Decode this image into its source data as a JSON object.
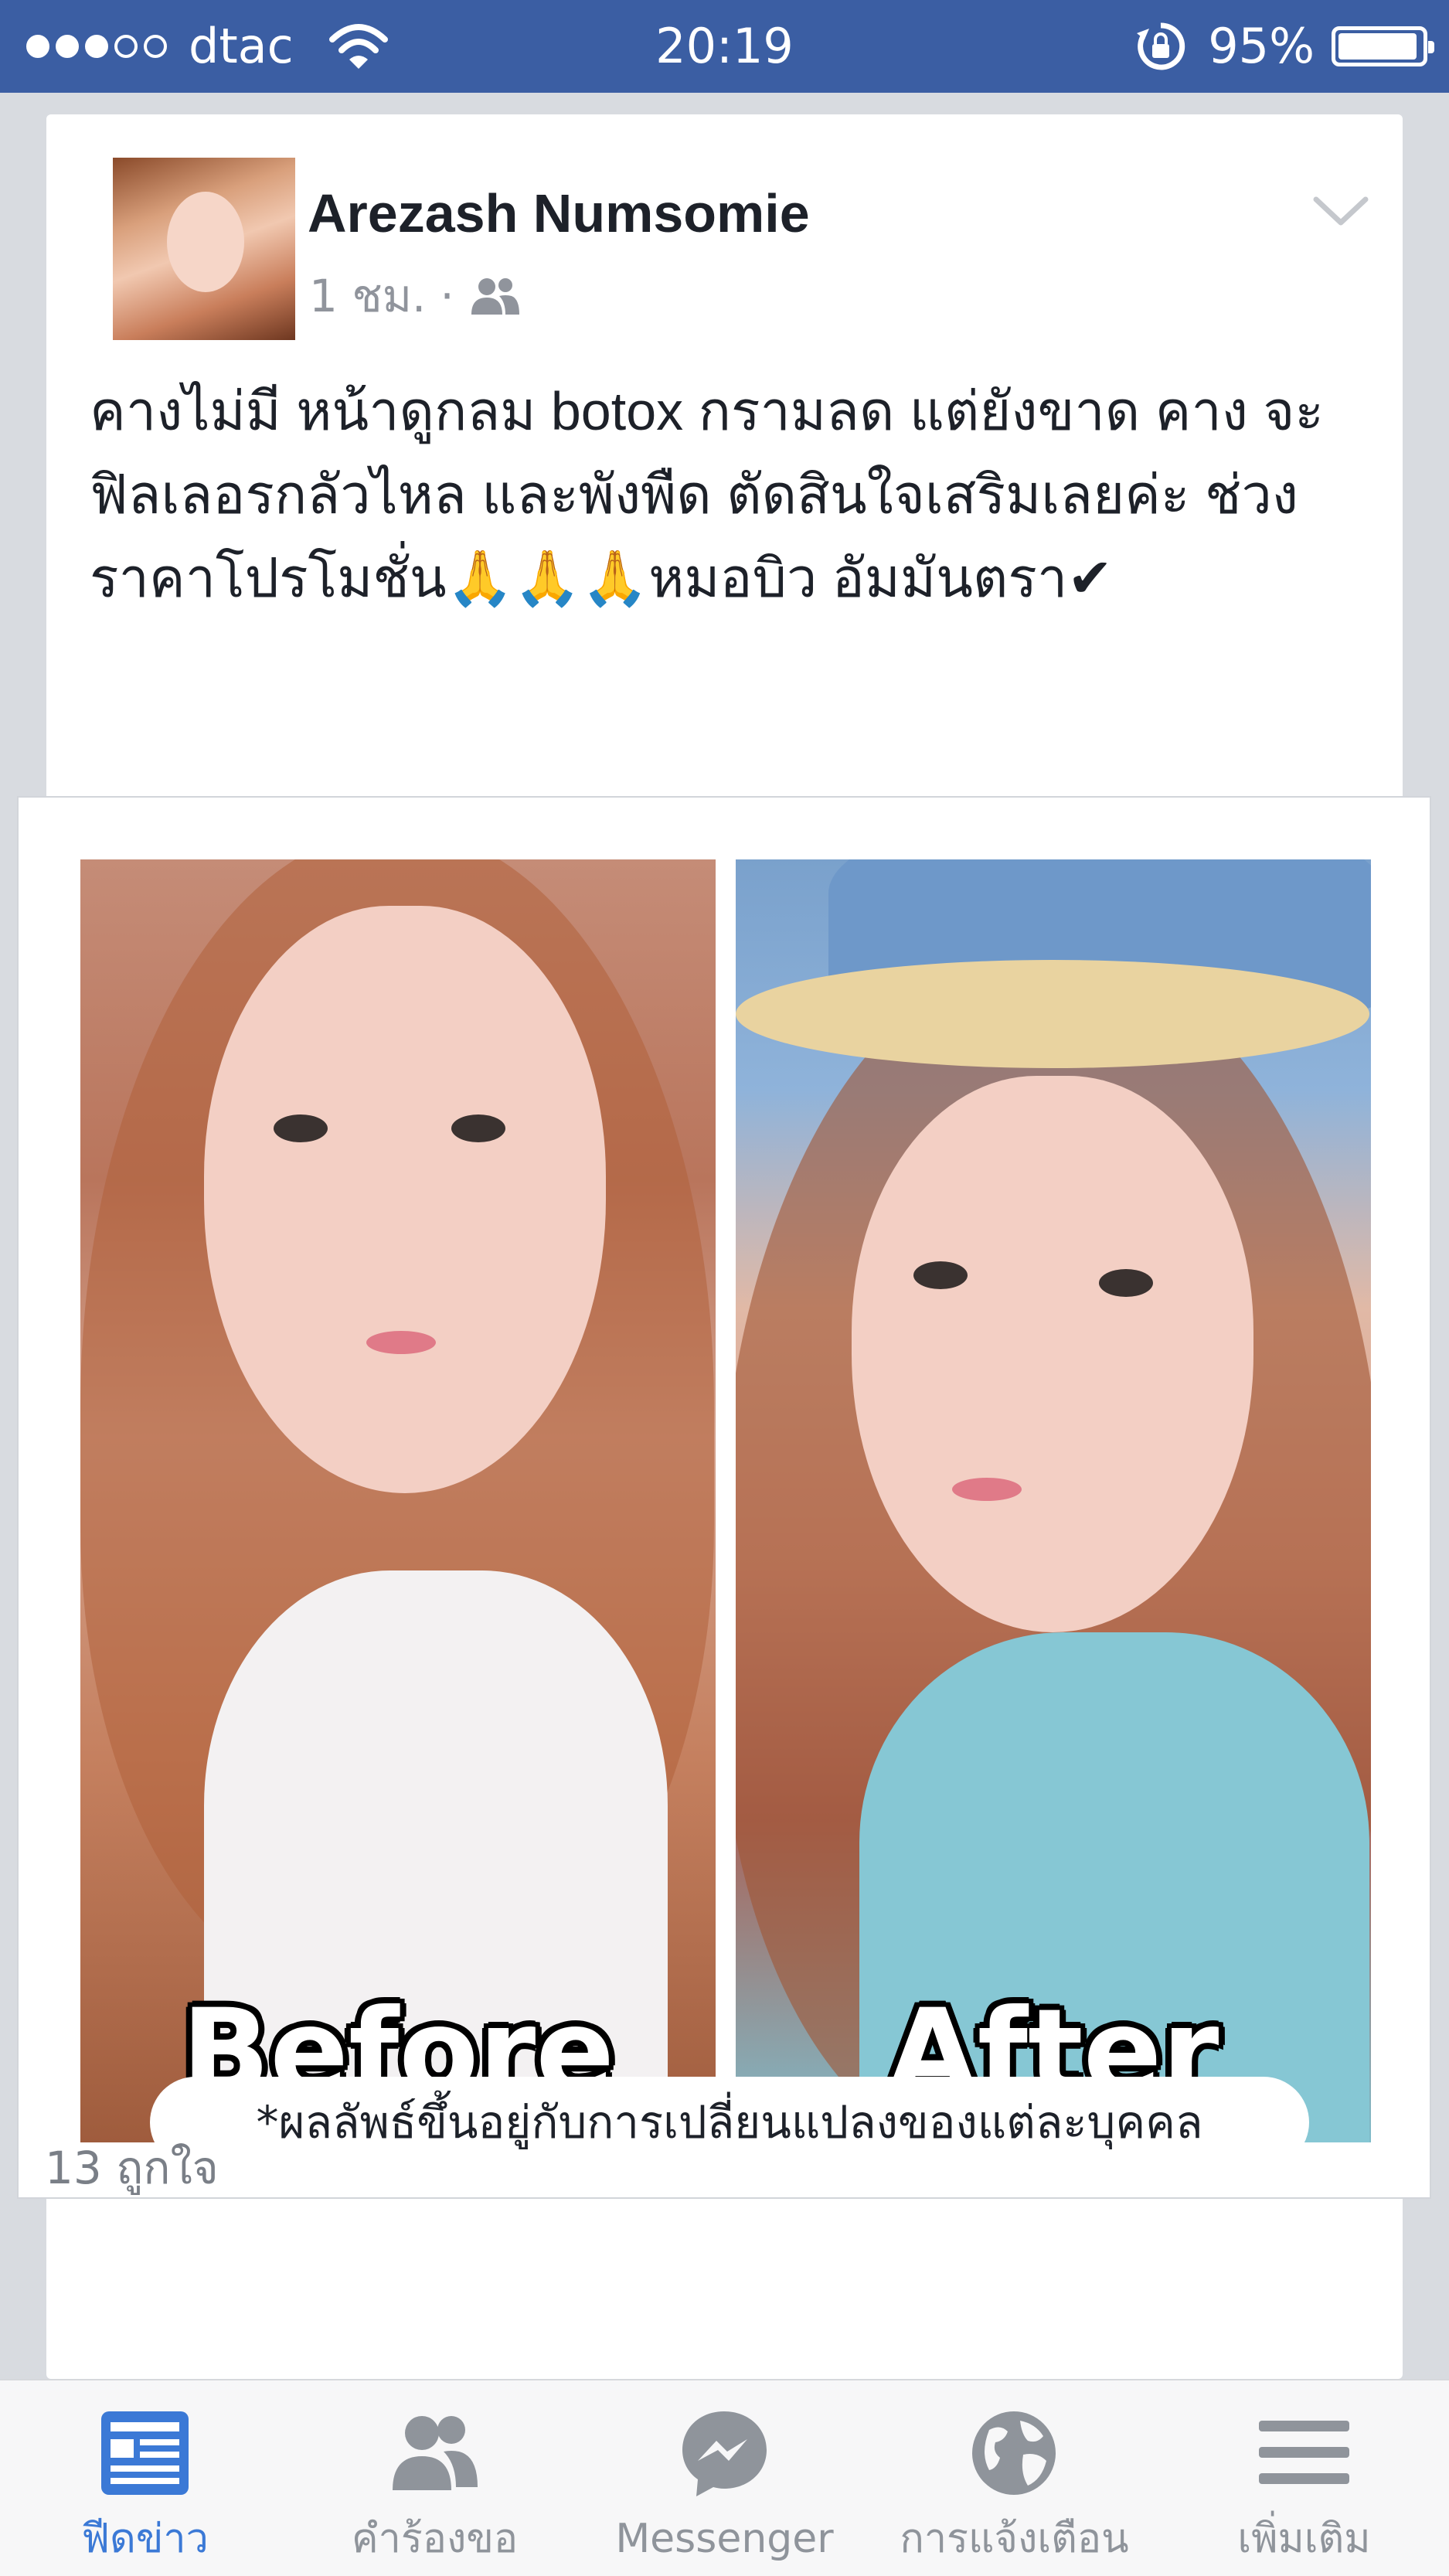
{
  "status_bar": {
    "carrier": "dtac",
    "time": "20:19",
    "battery_percent": "95%",
    "battery_level": 0.95,
    "signal_bars_filled": 3,
    "signal_bars_total": 5,
    "icons": [
      "wifi-icon",
      "rotation-lock-icon",
      "battery-icon"
    ]
  },
  "post": {
    "author": "Arezash Numsomie",
    "time_ago": "1 ชม.",
    "separator": "·",
    "audience_icon": "friends-icon",
    "text": "คางไม่มี หน้าดูกลม botox กรามลด แต่ยังขาด คาง จะฟิลเลอรกลัวไหล และพังพืด ตัดสินใจเสริมเลยค่ะ ช่วงราคาโปรโมชั่น🙏🙏🙏หมอบิว อัมมันตรา✔",
    "image": {
      "before_label": "Before",
      "after_label": "After",
      "disclaimer": "*ผลลัพธ์ขึ้นอยู่กับการเปลี่ยนแปลงของแต่ละบุคคล"
    },
    "likes": "13 ถูกใจ"
  },
  "tab_bar": {
    "active_color": "#3b79d6",
    "inactive_color": "#8f949b",
    "tabs": [
      {
        "label": "ฟีดข่าว",
        "icon": "news-feed-icon",
        "active": true
      },
      {
        "label": "คำร้องขอ",
        "icon": "friend-requests-icon",
        "active": false
      },
      {
        "label": "Messenger",
        "icon": "messenger-icon",
        "active": false
      },
      {
        "label": "การแจ้งเตือน",
        "icon": "globe-icon",
        "active": false
      },
      {
        "label": "เพิ่มเติม",
        "icon": "menu-icon",
        "active": false
      }
    ]
  },
  "colors": {
    "status_bar": "#3b5ea3",
    "background": "#d8dbe0",
    "card": "#ffffff"
  }
}
